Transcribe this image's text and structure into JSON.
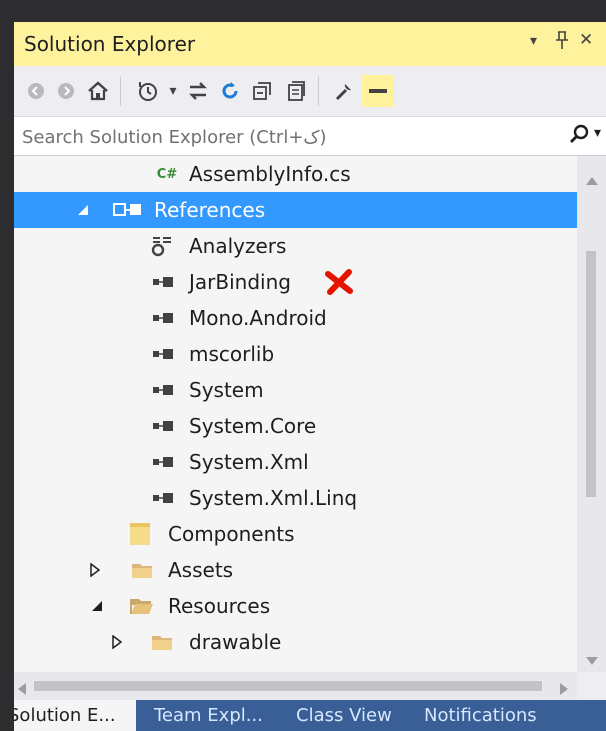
{
  "panel": {
    "title": "Solution Explorer",
    "title_buttons": {
      "dropdown": "▾",
      "pin": "⊥",
      "close": "✕"
    }
  },
  "toolbar": {
    "icons": [
      "back-icon",
      "forward-icon",
      "home-icon",
      "history-icon",
      "sync-icon",
      "refresh-icon",
      "collapse-all-icon",
      "show-all-files-icon",
      "properties-icon",
      "preview-icon"
    ]
  },
  "search": {
    "placeholder": "Search Solution Explorer (Ctrl+ک)"
  },
  "tree": {
    "items": [
      {
        "label": "AssemblyInfo.cs",
        "icon": "csharp-file-icon",
        "icon_text": "C#"
      },
      {
        "label": "References",
        "icon": "references-icon",
        "expanded": true,
        "selected": true
      },
      {
        "label": "Analyzers",
        "icon": "analyzers-icon"
      },
      {
        "label": "JarBinding",
        "icon": "reference-icon",
        "error": true
      },
      {
        "label": "Mono.Android",
        "icon": "reference-icon"
      },
      {
        "label": "mscorlib",
        "icon": "reference-icon"
      },
      {
        "label": "System",
        "icon": "reference-icon"
      },
      {
        "label": "System.Core",
        "icon": "reference-icon"
      },
      {
        "label": "System.Xml",
        "icon": "reference-icon"
      },
      {
        "label": "System.Xml.Linq",
        "icon": "reference-icon"
      },
      {
        "label": "Components",
        "icon": "folder-icon"
      },
      {
        "label": "Assets",
        "icon": "folder-icon",
        "expanded": false
      },
      {
        "label": "Resources",
        "icon": "folder-open-icon",
        "expanded": true
      },
      {
        "label": "drawable",
        "icon": "folder-icon",
        "expanded": false
      }
    ]
  },
  "tabs": [
    {
      "label": "Solution E...",
      "active": true
    },
    {
      "label": "Team Expl...",
      "active": false
    },
    {
      "label": "Class View",
      "active": false
    },
    {
      "label": "Notifications",
      "active": false
    }
  ],
  "colors": {
    "title_bar": "#fff29d",
    "selection": "#3399ff",
    "csharp_green": "#388a34",
    "error_red": "#e51400",
    "tab_band": "#3a5f96"
  }
}
